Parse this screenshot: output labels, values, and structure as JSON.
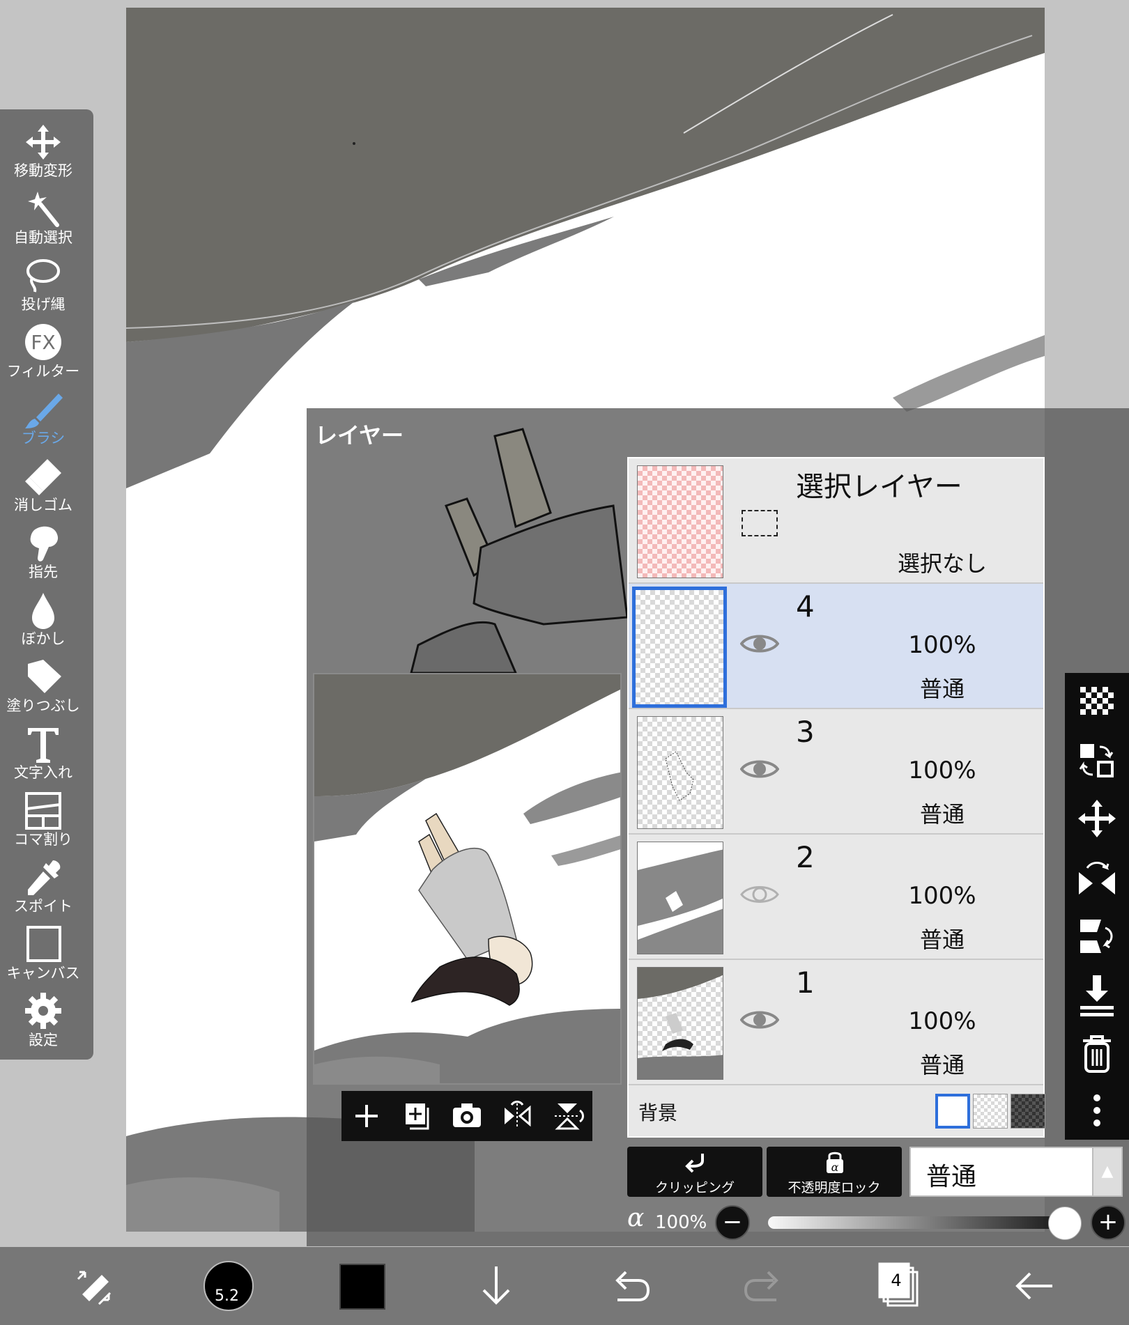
{
  "tools": [
    {
      "label": "移動変形",
      "icon": "move-transform-icon"
    },
    {
      "label": "自動選択",
      "icon": "magic-wand-icon"
    },
    {
      "label": "投げ縄",
      "icon": "lasso-icon"
    },
    {
      "label": "フィルター",
      "icon": "fx-filter-icon"
    },
    {
      "label": "ブラシ",
      "icon": "brush-icon",
      "active": true
    },
    {
      "label": "消しゴム",
      "icon": "eraser-icon"
    },
    {
      "label": "指先",
      "icon": "finger-smudge-icon"
    },
    {
      "label": "ぼかし",
      "icon": "blur-drop-icon"
    },
    {
      "label": "塗りつぶし",
      "icon": "fill-bucket-icon"
    },
    {
      "label": "文字入れ",
      "icon": "text-icon"
    },
    {
      "label": "コマ割り",
      "icon": "frame-divider-icon"
    },
    {
      "label": "スポイト",
      "icon": "eyedropper-icon"
    },
    {
      "label": "キャンバス",
      "icon": "canvas-icon"
    },
    {
      "label": "設定",
      "icon": "gear-icon"
    }
  ],
  "layer_panel": {
    "title": "レイヤー",
    "selection_layer": {
      "title": "選択レイヤー",
      "status": "選択なし"
    },
    "layers": [
      {
        "number": "4",
        "opacity": "100%",
        "blend": "普通",
        "visible": true,
        "selected": true
      },
      {
        "number": "3",
        "opacity": "100%",
        "blend": "普通",
        "visible": true,
        "selected": false
      },
      {
        "number": "2",
        "opacity": "100%",
        "blend": "普通",
        "visible": false,
        "selected": false
      },
      {
        "number": "1",
        "opacity": "100%",
        "blend": "普通",
        "visible": true,
        "selected": false
      }
    ],
    "background": {
      "label": "背景",
      "options": [
        "white",
        "transparent",
        "dark-checker"
      ],
      "selected": "white"
    },
    "clipping_label": "クリッピング",
    "opacity_lock_label": "不透明度ロック",
    "blend_mode": "普通",
    "alpha_symbol": "α",
    "alpha_value": "100%",
    "alpha_fraction": 1.0,
    "minus": "−",
    "plus": "+",
    "preview_toolbar_icons": [
      "add-layer-icon",
      "add-layer-stack-icon",
      "camera-icon",
      "flip-horizontal-icon",
      "flip-vertical-icon"
    ],
    "action_icons": [
      "transparency-checker-icon",
      "swap-layers-icon",
      "move-icon",
      "flip-horizontal-rotate-icon",
      "flip-vertical-rotate-icon",
      "merge-down-icon",
      "trash-icon",
      "more-vertical-icon"
    ]
  },
  "bottom_toolbar": {
    "brush_size": "5.2",
    "color": "#000000",
    "layer_count": "4",
    "icons": [
      "swap-tool-icon",
      "brush-size-icon",
      "color-swatch-icon",
      "move-down-icon",
      "undo-icon",
      "redo-icon",
      "layers-icon",
      "back-icon"
    ]
  },
  "colors": {
    "accent": "#2e6fdb",
    "active_tool": "#6aa8e8",
    "canvas_gray": "#6e6d68"
  }
}
